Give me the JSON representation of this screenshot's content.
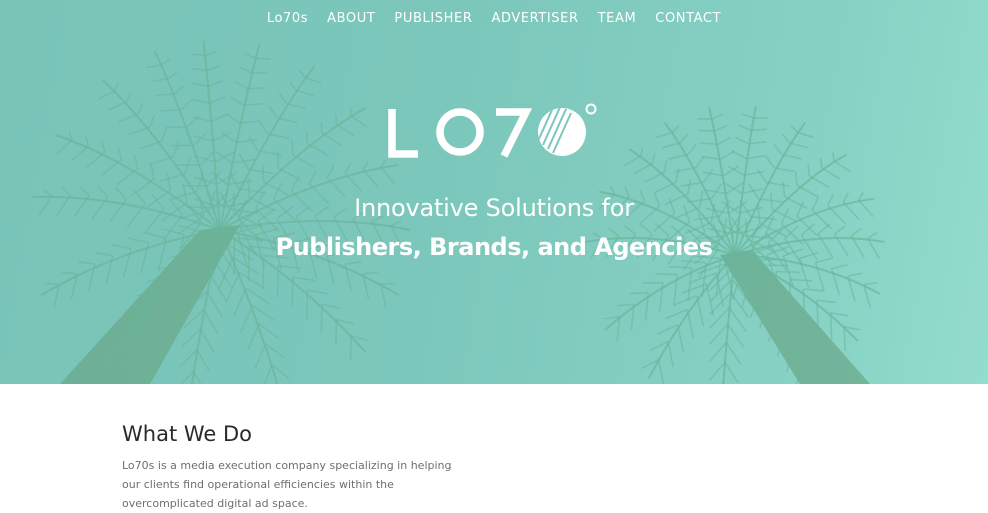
{
  "nav": {
    "items": [
      {
        "label": "Lo70s"
      },
      {
        "label": "ABOUT"
      },
      {
        "label": "PUBLISHER"
      },
      {
        "label": "ADVERTISER"
      },
      {
        "label": "TEAM"
      },
      {
        "label": "CONTACT"
      }
    ]
  },
  "hero": {
    "logo_text": "LO70°",
    "tagline_line1": "Innovative Solutions for",
    "tagline_line2": "Publishers, Brands, and Agencies"
  },
  "what_we_do": {
    "title": "What We Do",
    "body": "Lo70s is a media execution company specializing in helping our clients find operational efficiencies within the overcomplicated digital ad space."
  },
  "colors": {
    "hero_tint": "#7cc7bb",
    "palm_frond": "#6ab59b",
    "palm_trunk": "#6aa98c",
    "text_on_hero": "#ffffff",
    "heading": "#2a2a2a",
    "body_text": "#6f6f6f"
  }
}
